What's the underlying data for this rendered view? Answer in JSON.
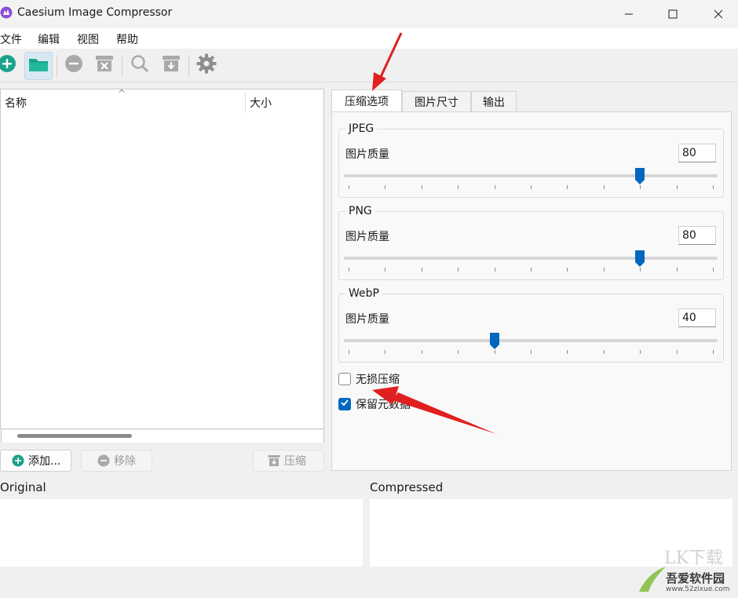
{
  "window": {
    "title": "Caesium Image Compressor",
    "app_icon": "caesium-logo-icon",
    "controls": [
      "minimize-icon",
      "maximize-icon",
      "close-icon"
    ]
  },
  "menu": {
    "items": [
      {
        "label": "文件"
      },
      {
        "label": "编辑"
      },
      {
        "label": "视图"
      },
      {
        "label": "帮助"
      }
    ]
  },
  "toolbar": {
    "buttons": [
      "add-icon",
      "folder-open-icon",
      "remove-icon",
      "clear-list-icon",
      "preview-icon",
      "compress-icon",
      "settings-icon"
    ]
  },
  "file_list": {
    "columns": [
      "名称",
      "大小"
    ],
    "sort_indicator": "^"
  },
  "actions": {
    "add_label": "添加...",
    "remove_label": "移除",
    "compress_label": "压缩"
  },
  "tabs": [
    {
      "label": "压缩选项",
      "active": true
    },
    {
      "label": "图片尺寸",
      "active": false
    },
    {
      "label": "输出",
      "active": false
    }
  ],
  "compression": {
    "groups": [
      {
        "title": "JPEG",
        "quality_label": "图片质量",
        "value": "80",
        "slider_fraction": 0.8
      },
      {
        "title": "PNG",
        "quality_label": "图片质量",
        "value": "80",
        "slider_fraction": 0.8
      },
      {
        "title": "WebP",
        "quality_label": "图片质量",
        "value": "40",
        "slider_fraction": 0.4
      }
    ],
    "lossless_label": "无损压缩",
    "lossless_checked": false,
    "keep_metadata_label": "保留元数据",
    "keep_metadata_checked": true
  },
  "preview": {
    "original_label": "Original",
    "compressed_label": "Compressed"
  },
  "watermark": {
    "brand": "吾爱软件园",
    "url": "www.52zixue.com"
  },
  "colors": {
    "accent": "#0067c0",
    "toolbar_green": "#1aa38a",
    "annotation_red": "#e02020"
  }
}
